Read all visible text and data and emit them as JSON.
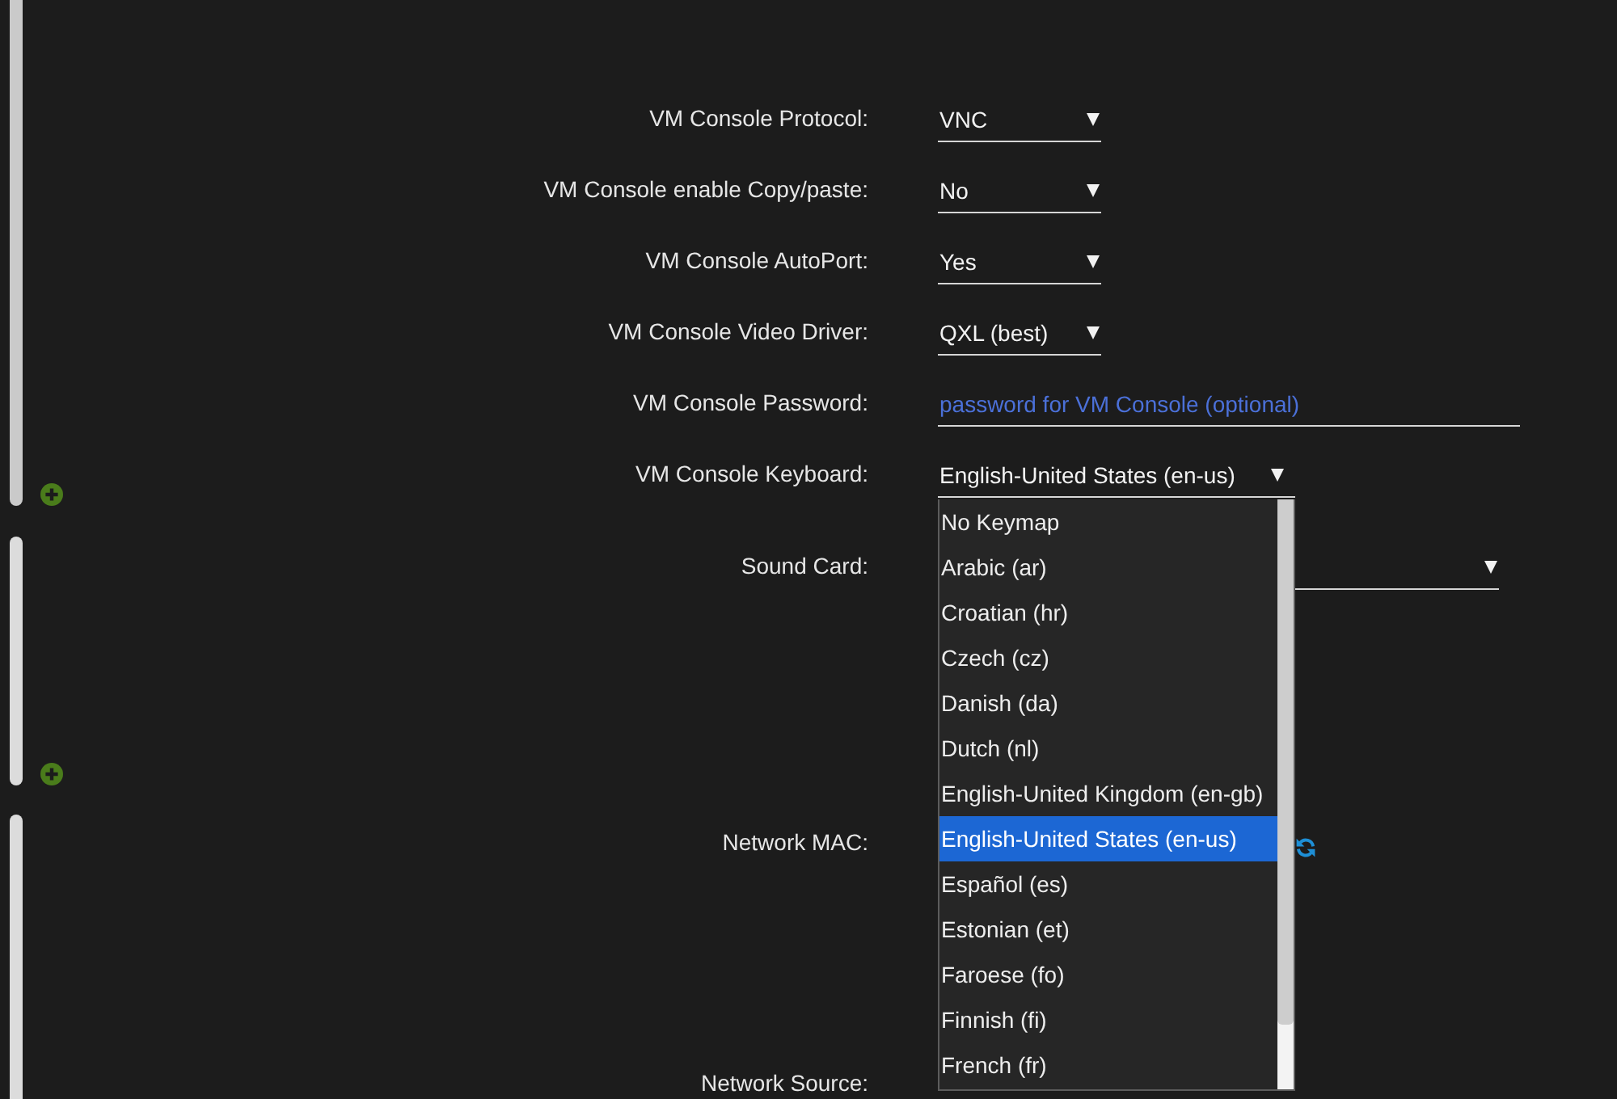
{
  "sections": [
    {
      "add_button": true,
      "fields": [
        {
          "kind": "select",
          "label": "VM Console Protocol:",
          "value": "VNC",
          "expanded": false
        },
        {
          "kind": "select",
          "label": "VM Console enable Copy/paste:",
          "value": "No",
          "expanded": false
        },
        {
          "kind": "select",
          "label": "VM Console AutoPort:",
          "value": "Yes",
          "expanded": false
        },
        {
          "kind": "select",
          "label": "VM Console Video Driver:",
          "value": "QXL (best)",
          "expanded": false
        },
        {
          "kind": "text",
          "label": "VM Console Password:",
          "placeholder": "password for VM Console (optional)"
        },
        {
          "kind": "select",
          "label": "VM Console Keyboard:",
          "value": "English-United States (en-us)",
          "expanded": true,
          "options": [
            {
              "label": "No Keymap",
              "selected": false
            },
            {
              "label": "Arabic (ar)",
              "selected": false
            },
            {
              "label": "Croatian (hr)",
              "selected": false
            },
            {
              "label": "Czech (cz)",
              "selected": false
            },
            {
              "label": "Danish (da)",
              "selected": false
            },
            {
              "label": "Dutch (nl)",
              "selected": false
            },
            {
              "label": "English-United Kingdom (en-gb)",
              "selected": false
            },
            {
              "label": "English-United States (en-us)",
              "selected": true
            },
            {
              "label": "Español (es)",
              "selected": false
            },
            {
              "label": "Estonian (et)",
              "selected": false
            },
            {
              "label": "Faroese (fo)",
              "selected": false
            },
            {
              "label": "Finnish (fi)",
              "selected": false
            },
            {
              "label": "French (fr)",
              "selected": false
            }
          ]
        }
      ]
    },
    {
      "add_button": true,
      "fields": [
        {
          "kind": "select",
          "label": "Sound Card:",
          "expanded": false
        }
      ]
    },
    {
      "add_button": false,
      "fields": [
        {
          "kind": "mac",
          "label": "Network MAC:"
        },
        {
          "kind": "label",
          "label": "Network Source:"
        }
      ]
    }
  ]
}
